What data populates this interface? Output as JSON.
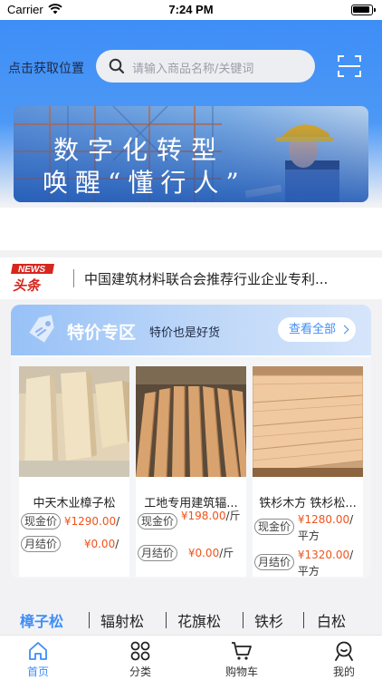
{
  "status_bar": {
    "carrier": "Carrier",
    "time": "7:24 PM"
  },
  "header": {
    "location_label": "点击获取位置",
    "search_placeholder": "请输入商品名称/关键词",
    "accent_color": "#3e8ef7"
  },
  "banner": {
    "line1": "数字化转型",
    "line2": "唤醒“懂行人”",
    "pages": 2,
    "active_page": 2
  },
  "news": {
    "logo_top": "NEWS",
    "logo_bottom": "头条",
    "headline": "中国建筑材料联合会推荐行业企业专利..."
  },
  "special": {
    "title": "特价专区",
    "subtitle": "特价也是好货",
    "view_all": "查看全部",
    "products": [
      {
        "name": "中天木业樟子松",
        "cash_label": "现金价",
        "cash_price": "¥1290.00",
        "cash_unit": "/",
        "monthly_label": "月结价",
        "monthly_price": "¥0.00",
        "monthly_unit": "/"
      },
      {
        "name": "工地专用建筑辐...",
        "cash_label": "现金价",
        "cash_price": "¥198.00",
        "cash_unit": "/斤",
        "monthly_label": "月结价",
        "monthly_price": "¥0.00",
        "monthly_unit": "/斤"
      },
      {
        "name": "铁杉木方 铁杉松...",
        "cash_label": "现金价",
        "cash_price": "¥1280.00",
        "cash_unit": "/平方",
        "monthly_label": "月结价",
        "monthly_price": "¥1320.00",
        "monthly_unit": "/平方"
      }
    ]
  },
  "categories": [
    {
      "label": "樟子松",
      "active": true
    },
    {
      "label": "辐射松",
      "active": false
    },
    {
      "label": "花旗松",
      "active": false
    },
    {
      "label": "铁杉",
      "active": false
    },
    {
      "label": "白松",
      "active": false
    }
  ],
  "tabbar": [
    {
      "label": "首页",
      "icon": "home-icon",
      "active": true
    },
    {
      "label": "分类",
      "icon": "grid-icon",
      "active": false
    },
    {
      "label": "购物车",
      "icon": "cart-icon",
      "active": false
    },
    {
      "label": "我的",
      "icon": "profile-icon",
      "active": false
    }
  ]
}
